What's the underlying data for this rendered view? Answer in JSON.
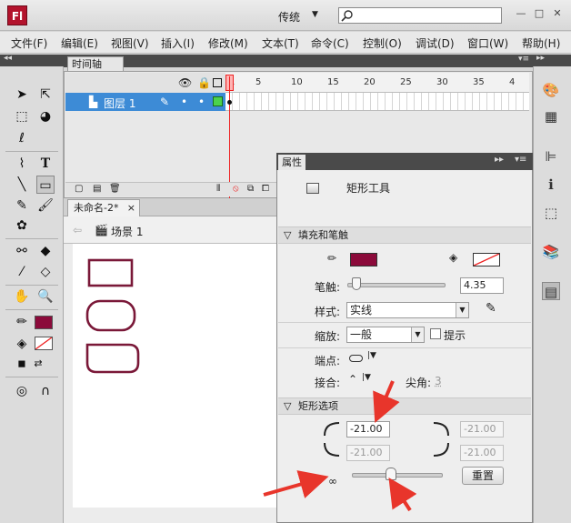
{
  "app": {
    "logo_text": "Fl",
    "workspace": "传统"
  },
  "search": {
    "placeholder": ""
  },
  "window_controls": {
    "minimize": "—",
    "restore": "□",
    "close": "✕"
  },
  "menubar": {
    "items": [
      {
        "label": "文件(F)"
      },
      {
        "label": "编辑(E)"
      },
      {
        "label": "视图(V)"
      },
      {
        "label": "插入(I)"
      },
      {
        "label": "修改(M)"
      },
      {
        "label": "文本(T)"
      },
      {
        "label": "命令(C)"
      },
      {
        "label": "控制(O)"
      },
      {
        "label": "调试(D)"
      },
      {
        "label": "窗口(W)"
      },
      {
        "label": "帮助(H)"
      }
    ]
  },
  "timeline": {
    "tab_label": "时间轴",
    "layer_name": "图层 1",
    "ruler": [
      "1",
      "5",
      "10",
      "15",
      "20",
      "25",
      "30",
      "35",
      "4"
    ]
  },
  "document": {
    "tab_label": "未命名-2*",
    "tab_close": "×",
    "scene_label": "场景 1"
  },
  "properties": {
    "tab_label": "属性",
    "tool_name": "矩形工具",
    "fill_stroke_section": "填充和笔触",
    "stroke_label": "笔触:",
    "stroke_value": "4.35",
    "stroke_fraction": 0.05,
    "style_label": "样式:",
    "style_value": "实线",
    "scale_label": "缩放:",
    "scale_value": "一般",
    "hint_label": "提示",
    "cap_label": "端点:",
    "join_label": "接合:",
    "miter_label": "尖角:",
    "miter_value": "3",
    "rect_options_section": "矩形选项",
    "corners": {
      "top_left": "-21.00",
      "top_right": "-21.00",
      "bottom_left": "-21.00",
      "bottom_right": "-21.00"
    },
    "corner_slider_fraction": 0.42,
    "reset_label": "重置"
  },
  "colors": {
    "stroke_color": "#8b0a3a",
    "shape_stroke": "#7a1838",
    "arrow": "#e8352b"
  }
}
